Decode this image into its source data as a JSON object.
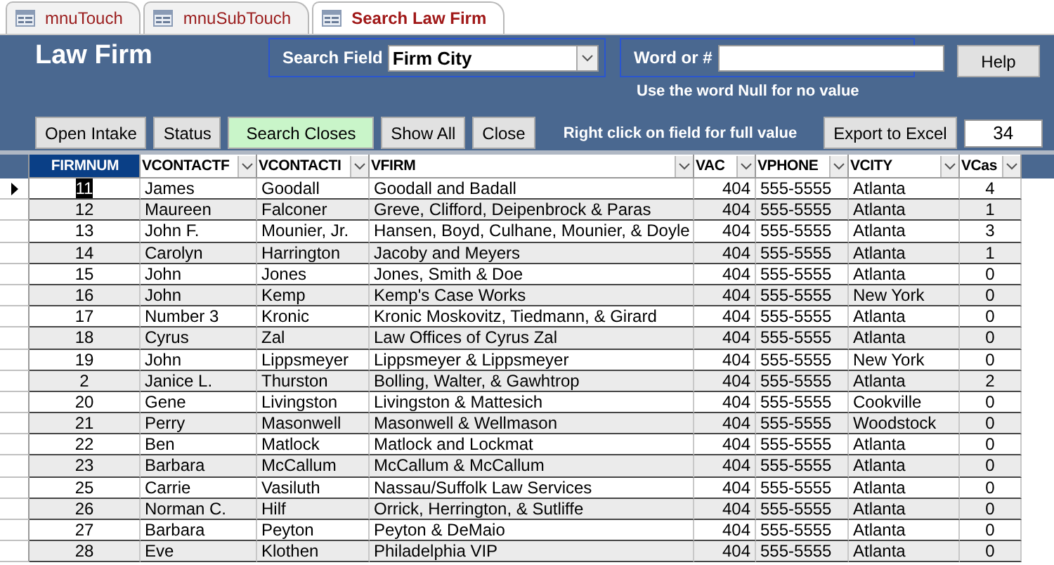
{
  "tabs": [
    {
      "label": "mnuTouch",
      "selected": false
    },
    {
      "label": "mnuSubTouch",
      "selected": false
    },
    {
      "label": "Search Law Firm",
      "selected": true
    }
  ],
  "form": {
    "title": "Law Firm",
    "search_field": {
      "label": "Search Field",
      "value": "Firm City"
    },
    "word": {
      "label": "Word or #"
    },
    "help": "Help",
    "hint": "Use the word Null for no value",
    "buttons": [
      {
        "label": "Open Intake",
        "kind": "plain"
      },
      {
        "label": "Status",
        "kind": "plain"
      },
      {
        "label": "Search Closes",
        "kind": "highlight"
      },
      {
        "label": "Show All",
        "kind": "plain"
      },
      {
        "label": "Close",
        "kind": "plain"
      }
    ],
    "note": "Right click on field for full value",
    "export": "Export to Excel",
    "count": "34"
  },
  "table": {
    "columns": [
      {
        "label": "FIRMNUM",
        "selected": true,
        "filter": false
      },
      {
        "label": "VCONTACTF",
        "selected": false,
        "filter": true
      },
      {
        "label": "VCONTACTI",
        "selected": false,
        "filter": true
      },
      {
        "label": "VFIRM",
        "selected": false,
        "filter": true
      },
      {
        "label": "VAC",
        "selected": false,
        "filter": true
      },
      {
        "label": "VPHONE",
        "selected": false,
        "filter": true
      },
      {
        "label": "VCITY",
        "selected": false,
        "filter": true
      },
      {
        "label": "VCas",
        "selected": false,
        "filter": true
      }
    ],
    "rows": [
      {
        "selected": true,
        "cells": [
          "11",
          "James",
          "Goodall",
          "Goodall and Badall",
          "404",
          "555-5555",
          "Atlanta",
          "4"
        ]
      },
      {
        "selected": false,
        "cells": [
          "12",
          "Maureen",
          "Falconer",
          "Greve, Clifford, Deipenbrock & Paras",
          "404",
          "555-5555",
          "Atlanta",
          "1"
        ]
      },
      {
        "selected": false,
        "cells": [
          "13",
          "John F.",
          "Mounier, Jr.",
          "Hansen, Boyd, Culhane, Mounier, & Doyle",
          "404",
          "555-5555",
          "Atlanta",
          "3"
        ]
      },
      {
        "selected": false,
        "cells": [
          "14",
          "Carolyn",
          "Harrington",
          "Jacoby and Meyers",
          "404",
          "555-5555",
          "Atlanta",
          "1"
        ]
      },
      {
        "selected": false,
        "cells": [
          "15",
          "John",
          "Jones",
          "Jones, Smith & Doe",
          "404",
          "555-5555",
          "Atlanta",
          "0"
        ]
      },
      {
        "selected": false,
        "cells": [
          "16",
          "John",
          "Kemp",
          "Kemp's Case Works",
          "404",
          "555-5555",
          "New York",
          "0"
        ]
      },
      {
        "selected": false,
        "cells": [
          "17",
          "Number 3",
          "Kronic",
          "Kronic Moskovitz, Tiedmann, & Girard",
          "404",
          "555-5555",
          "Atlanta",
          "0"
        ]
      },
      {
        "selected": false,
        "cells": [
          "18",
          "Cyrus",
          "Zal",
          "Law Offices of Cyrus Zal",
          "404",
          "555-5555",
          "Atlanta",
          "0"
        ]
      },
      {
        "selected": false,
        "cells": [
          "19",
          "John",
          "Lippsmeyer",
          "Lippsmeyer & Lippsmeyer",
          "404",
          "555-5555",
          "New York",
          "0"
        ]
      },
      {
        "selected": false,
        "cells": [
          "2",
          "Janice L.",
          "Thurston",
          "Bolling, Walter, & Gawhtrop",
          "404",
          "555-5555",
          "Atlanta",
          "2"
        ]
      },
      {
        "selected": false,
        "cells": [
          "20",
          "Gene",
          "Livingston",
          "Livingston & Mattesich",
          "404",
          "555-5555",
          "Cookville",
          "0"
        ]
      },
      {
        "selected": false,
        "cells": [
          "21",
          "Perry",
          "Masonwell",
          "Masonwell & Wellmason",
          "404",
          "555-5555",
          "Woodstock",
          "0"
        ]
      },
      {
        "selected": false,
        "cells": [
          "22",
          "Ben",
          "Matlock",
          "Matlock and Lockmat",
          "404",
          "555-5555",
          "Atlanta",
          "0"
        ]
      },
      {
        "selected": false,
        "cells": [
          "23",
          "Barbara",
          "McCallum",
          "McCallum & McCallum",
          "404",
          "555-5555",
          "Atlanta",
          "0"
        ]
      },
      {
        "selected": false,
        "cells": [
          "25",
          "Carrie",
          "Vasiluth",
          "Nassau/Suffolk Law Services",
          "404",
          "555-5555",
          "Atlanta",
          "0"
        ]
      },
      {
        "selected": false,
        "cells": [
          "26",
          "Norman C.",
          "Hilf",
          "Orrick, Herrington, & Sutliffe",
          "404",
          "555-5555",
          "Atlanta",
          "0"
        ]
      },
      {
        "selected": false,
        "cells": [
          "27",
          "Barbara",
          "Peyton",
          "Peyton & DeMaio",
          "404",
          "555-5555",
          "Atlanta",
          "0"
        ]
      },
      {
        "selected": false,
        "cells": [
          "28",
          "Eve",
          "Klothen",
          "Philadelphia VIP",
          "404",
          "555-5555",
          "Atlanta",
          "0"
        ]
      }
    ]
  }
}
